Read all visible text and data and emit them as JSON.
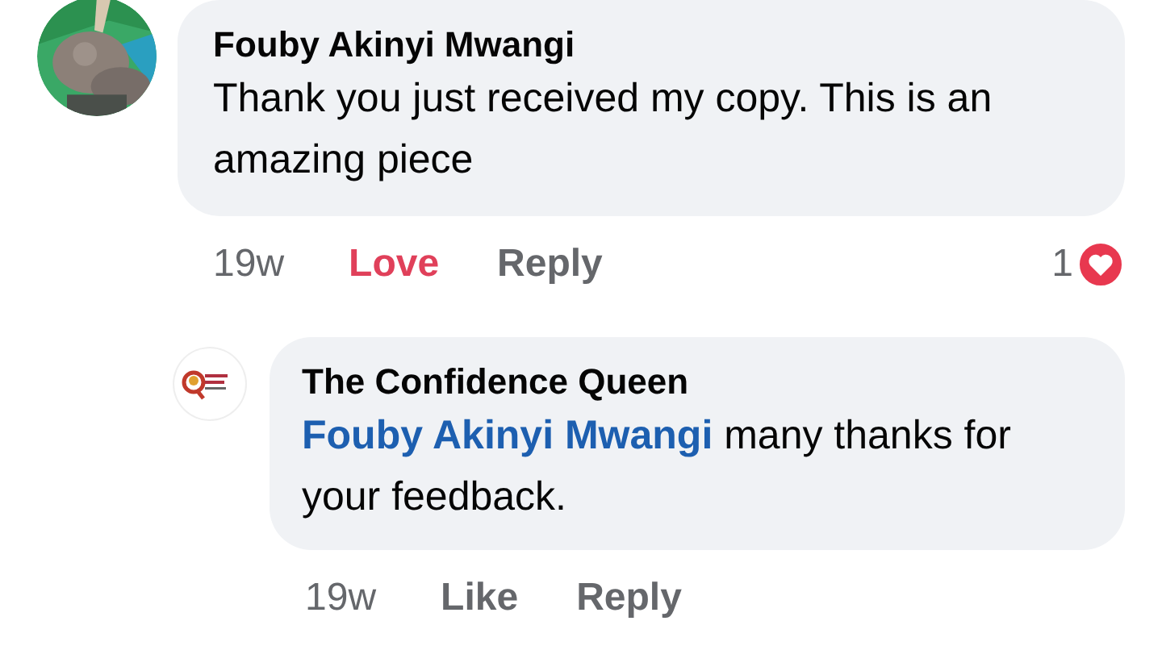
{
  "comments": [
    {
      "author": "Fouby Akinyi Mwangi",
      "avatar": {
        "kind": "picture"
      },
      "text": "Thank you just received my copy. This is an amazing piece",
      "time": "19w",
      "actions": [
        {
          "label": "Love",
          "active": true
        },
        {
          "label": "Reply",
          "active": false
        }
      ],
      "reactions": {
        "count": "1",
        "kind": "love"
      },
      "replies": [
        {
          "author": "The Confidence Queen",
          "avatar": {
            "kind": "logo"
          },
          "mention": "Fouby Akinyi Mwangi",
          "text": "many thanks for your feedback.",
          "time": "19w",
          "actions": [
            {
              "label": "Like",
              "active": false
            },
            {
              "label": "Reply",
              "active": false
            }
          ]
        }
      ]
    }
  ]
}
